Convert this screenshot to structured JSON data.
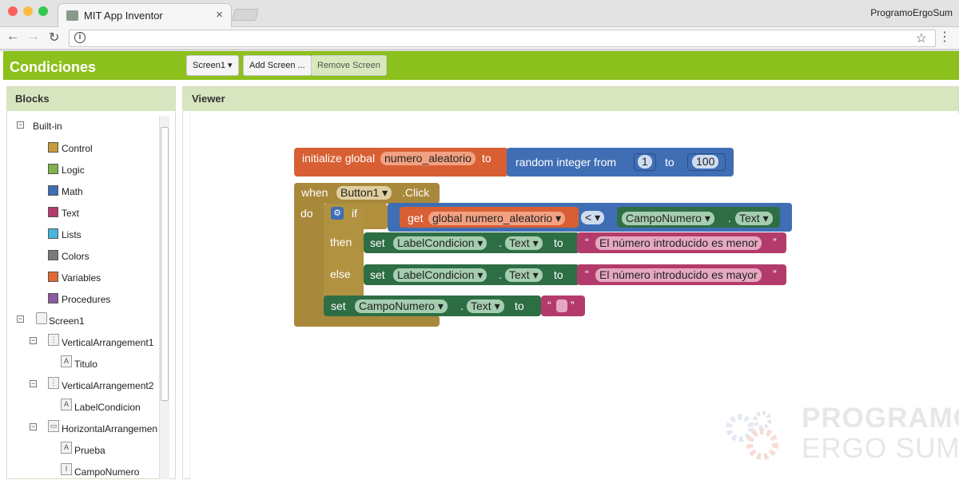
{
  "browser": {
    "tab_title": "MIT App Inventor",
    "profile": "ProgramoErgoSum"
  },
  "app": {
    "project": "Condiciones",
    "screen_select": "Screen1",
    "add_screen": "Add Screen ...",
    "remove_screen": "Remove Screen"
  },
  "blocks_panel": {
    "title": "Blocks",
    "builtin": "Built-in",
    "categories": [
      {
        "label": "Control",
        "color": "#c89b3a"
      },
      {
        "label": "Logic",
        "color": "#7fb24a"
      },
      {
        "label": "Math",
        "color": "#3f6eb5"
      },
      {
        "label": "Text",
        "color": "#b33b6b"
      },
      {
        "label": "Lists",
        "color": "#48b4e0"
      },
      {
        "label": "Colors",
        "color": "#7a7a7a"
      },
      {
        "label": "Variables",
        "color": "#e36a34"
      },
      {
        "label": "Procedures",
        "color": "#8b5aa0"
      }
    ],
    "components": [
      "Screen1",
      "VerticalArrangement1",
      "Titulo",
      "VerticalArrangement2",
      "LabelCondicion",
      "HorizontalArrangemen",
      "Prueba",
      "CampoNumero"
    ]
  },
  "viewer": {
    "title": "Viewer"
  },
  "code": {
    "init": "initialize global",
    "var": "numero_aleatorio",
    "to": "to",
    "random": "random integer from",
    "from_val": "1",
    "to_val": "100",
    "when": "when",
    "button": "Button1",
    "click": ".Click",
    "do": "do",
    "if": "if",
    "get": "get",
    "global_var": "global numero_aleatorio",
    "op": "<",
    "campo": "CampoNumero",
    "text_prop": "Text",
    "dot": ".",
    "then": "then",
    "set": "set",
    "label": "LabelCondicion",
    "msg_menor": "El número introducido es menor",
    "else": "else",
    "msg_mayor": "El número introducido es mayor"
  },
  "watermark": {
    "line1": "PROGRAMO",
    "line2": "ERGO SUM"
  },
  "colors": {
    "green_bar": "#8cc01c",
    "control": "#a8883a",
    "math": "#3f6eb5",
    "variable": "#d85f33",
    "text": "#b33b6b",
    "component": "#2e6e45"
  }
}
